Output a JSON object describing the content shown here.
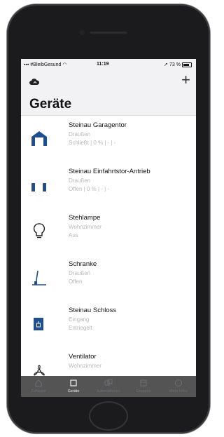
{
  "status_bar": {
    "carrier": "#BleibGesund",
    "time": "11:19",
    "battery": "73 %"
  },
  "header": {
    "title": "Geräte",
    "add_label": "+"
  },
  "devices": [
    {
      "name": "Steinau Garagentor",
      "location": "Draußen",
      "status": "Schließt | 0 % | - | -",
      "icon": "garage-icon"
    },
    {
      "name": "Steinau Einfahrtstor-Antrieb",
      "location": "Draußen",
      "status": "Offen | 0 % | - | -",
      "icon": "gate-icon"
    },
    {
      "name": "Stehlampe",
      "location": "Wohnzimmer",
      "status": "Aus",
      "icon": "lightbulb-icon"
    },
    {
      "name": "Schranke",
      "location": "Draußen",
      "status": "Offen",
      "icon": "barrier-icon"
    },
    {
      "name": "Steinau Schloss",
      "location": "Eingang",
      "status": "Entriegelt",
      "icon": "lock-icon"
    },
    {
      "name": "Ventilator",
      "location": "Wohnzimmer",
      "status": "",
      "icon": "fan-icon"
    }
  ],
  "tabs": [
    {
      "label": "Zuhause",
      "active": false
    },
    {
      "label": "Geräte",
      "active": true
    },
    {
      "label": "Automationen",
      "active": false
    },
    {
      "label": "Gruppen",
      "active": false
    },
    {
      "label": "Mehr Infos",
      "active": false
    }
  ],
  "colors": {
    "accent": "#1f4f8f",
    "tabbar": "#3c3c3e",
    "subtext": "#b8b8bc"
  }
}
